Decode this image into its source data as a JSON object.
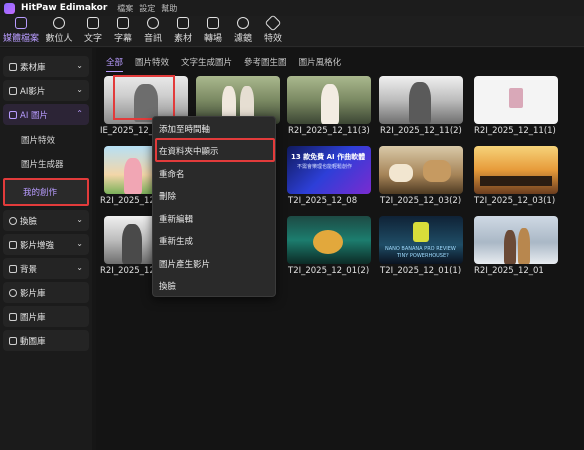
{
  "app": {
    "title": "HitPaw Edimakor",
    "menu": [
      "檔案",
      "設定",
      "幫助"
    ]
  },
  "toolbar": {
    "items": [
      "媒體檔案",
      "數位人",
      "文字",
      "字幕",
      "音訊",
      "素材",
      "轉場",
      "濾鏡",
      "特效"
    ],
    "active_index": 0
  },
  "sidebar": {
    "items": [
      {
        "label": "素材庫",
        "chevron": "⌄"
      },
      {
        "label": "AI影片",
        "chevron": "⌄"
      },
      {
        "label": "AI 圖片",
        "chevron": "⌃"
      }
    ],
    "subitems": [
      "圖片特效",
      "圖片生成器",
      "我的創作"
    ],
    "items_after": [
      {
        "label": "換臉",
        "chevron": "⌄"
      },
      {
        "label": "影片增強",
        "chevron": "⌄"
      },
      {
        "label": "背景",
        "chevron": "⌄"
      },
      {
        "label": "影片庫",
        "chevron": ""
      },
      {
        "label": "圖片庫",
        "chevron": ""
      },
      {
        "label": "動圖庫",
        "chevron": ""
      }
    ]
  },
  "tabs": [
    "全部",
    "圖片特效",
    "文字生成圖片",
    "參考圖生圖",
    "圖片風格化"
  ],
  "grid": {
    "captions": [
      "IE_2025_12_13",
      "",
      "R2I_2025_12_11(3)",
      "R2I_2025_12_11(2)",
      "R2I_2025_12_11(1)",
      "R2I_2025_12_1",
      "",
      "T2I_2025_12_08",
      "T2I_2025_12_03(2)",
      "T2I_2025_12_03(1)",
      "R2I_2025_12_0",
      "",
      "T2I_2025_12_01(2)",
      "T2I_2025_12_01(1)",
      "R2I_2025_12_01"
    ],
    "blue_thumb_text": "13 款免費 AI 作曲軟體",
    "blue_thumb_sub": "不需會樂理也能輕鬆創作",
    "tech_thumb_text": "NANO BANANA PRO REVIEW",
    "tech_thumb_sub": "TINY POWERHOUSE?"
  },
  "context_menu": {
    "items": [
      "添加至時間軸",
      "在資料夾中顯示",
      "重命名",
      "刪除",
      "重新編輯",
      "重新生成",
      "圖片產生影片",
      "換臉"
    ],
    "highlighted_index": 1
  },
  "colors": {
    "accent": "#b89cff",
    "highlight_frame": "#e23b3b"
  }
}
